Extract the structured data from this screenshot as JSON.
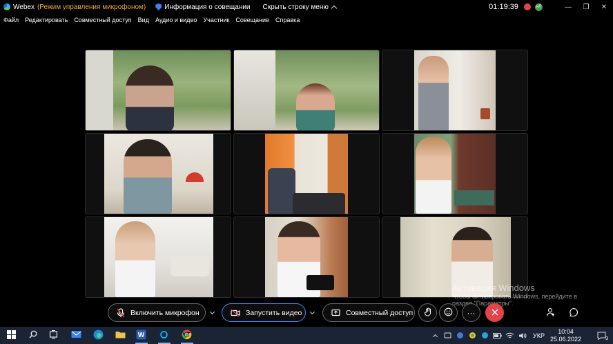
{
  "titlebar": {
    "app_name": "Webex",
    "mode": "(Режим управления микрофоном)",
    "meeting_info": "Информация о совещании",
    "hide_menu": "Скрыть строку меню",
    "time": "01:19:39",
    "avatar_initials": "нЛ",
    "minimize": "—",
    "restore": "❐",
    "close": "✕"
  },
  "menu": [
    "Файл",
    "Редактировать",
    "Совместный доступ",
    "Вид",
    "Аудио и видео",
    "Участник",
    "Совещание",
    "Справка"
  ],
  "controls": {
    "unmute": "Включить микрофон",
    "start_video": "Запустить видео",
    "share": "Совместный доступ",
    "more": "···"
  },
  "watermark": {
    "title": "Активация Windows",
    "line1": "Чтобы активировать Windows, перейдите в",
    "line2": "раздел \"Параметры\"."
  },
  "taskbar": {
    "language": "УКР",
    "time": "10:04",
    "date": "25.06.2022",
    "notification_count": "3"
  },
  "colors": {
    "mode_text": "#f2a735",
    "end_call": "#e3434a",
    "taskbar": "#1b2435",
    "accent": "#3b82f6"
  }
}
